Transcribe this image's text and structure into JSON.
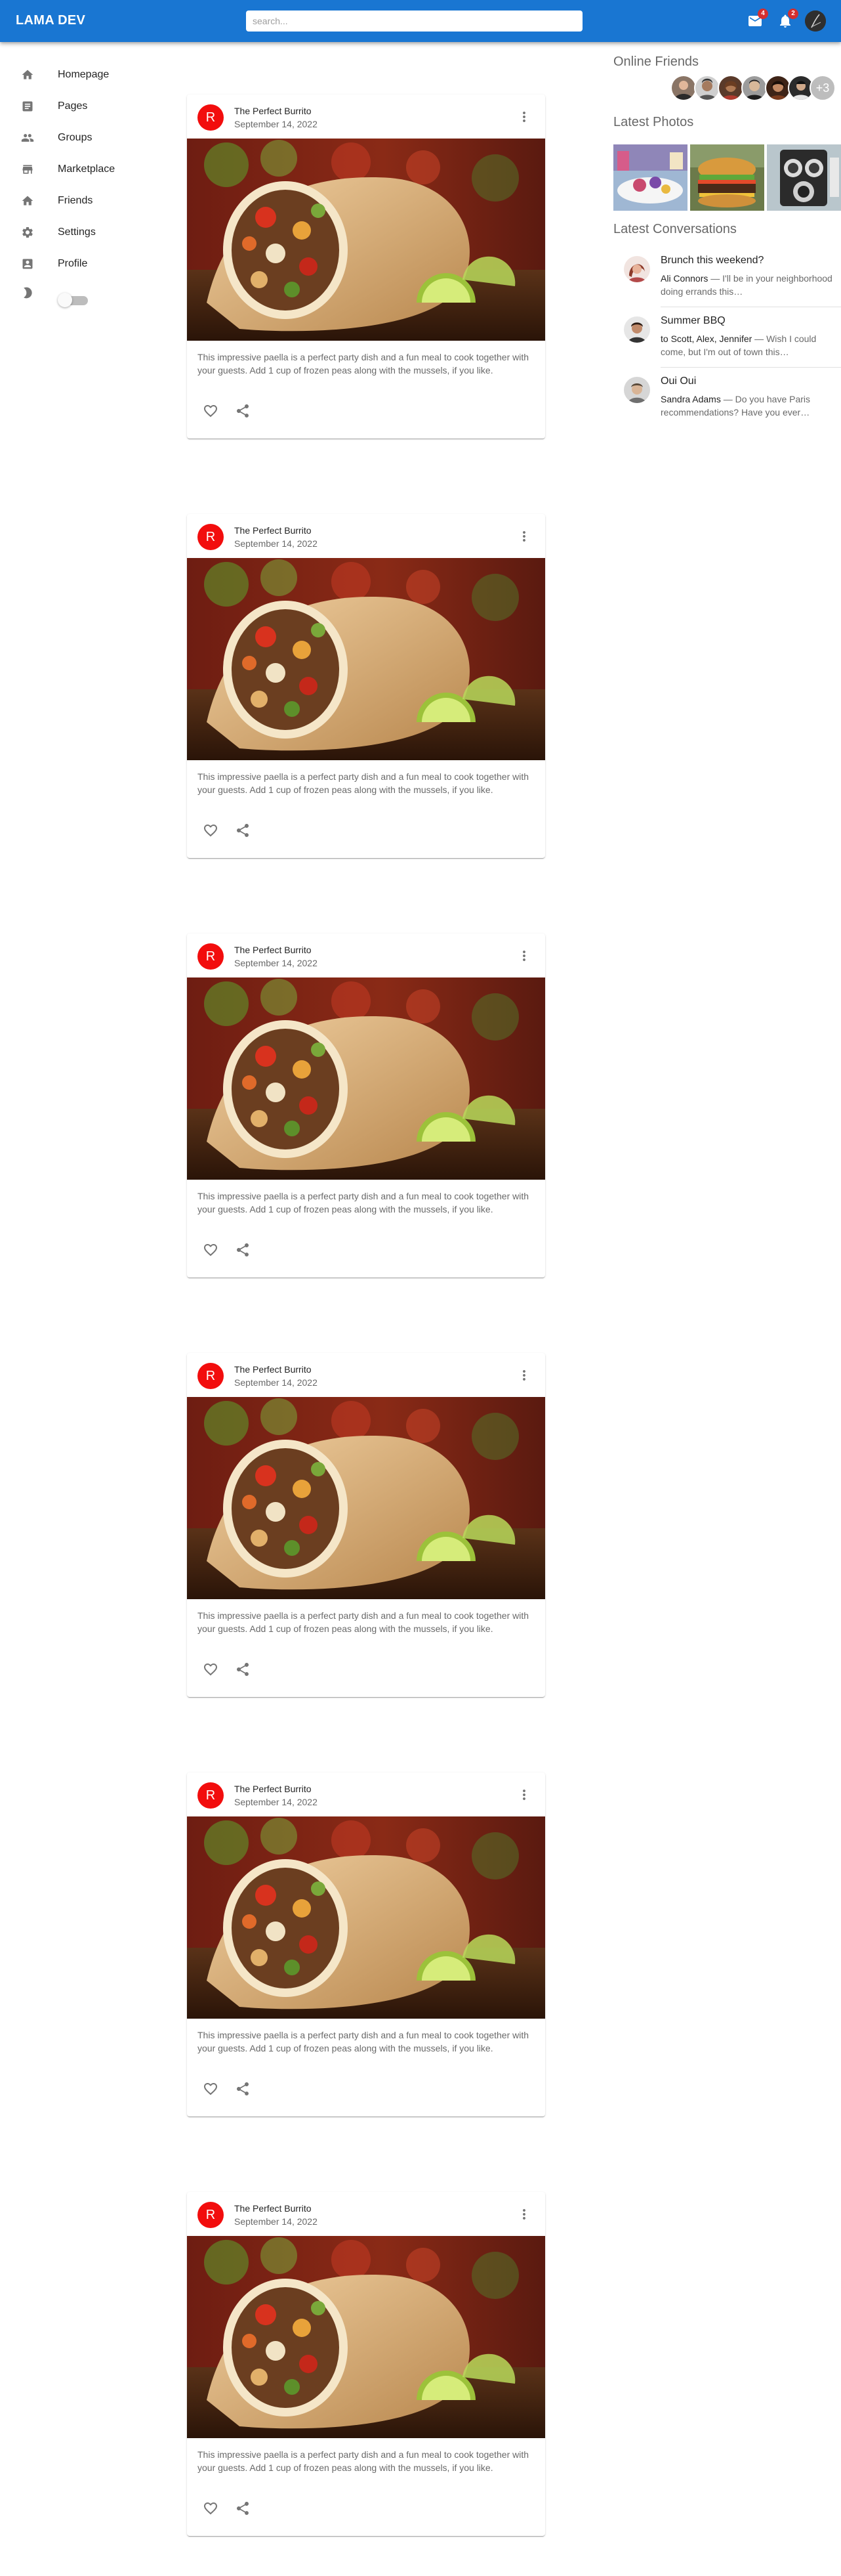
{
  "app": {
    "title": "LAMA DEV"
  },
  "search": {
    "placeholder": "search..."
  },
  "header": {
    "mail_badge": "4",
    "notifications_badge": "2"
  },
  "sidebar": {
    "items": [
      {
        "label": "Homepage",
        "icon": "home-icon"
      },
      {
        "label": "Pages",
        "icon": "article-icon"
      },
      {
        "label": "Groups",
        "icon": "group-icon"
      },
      {
        "label": "Marketplace",
        "icon": "storefront-icon"
      },
      {
        "label": "Friends",
        "icon": "home-icon"
      },
      {
        "label": "Settings",
        "icon": "settings-icon"
      },
      {
        "label": "Profile",
        "icon": "account-box-icon"
      }
    ],
    "dark_mode_enabled": false
  },
  "feed": {
    "posts": [
      {
        "avatar_letter": "R",
        "title": "The Perfect Burrito",
        "date": "September 14, 2022",
        "text": "This impressive paella is a perfect party dish and a fun meal to cook together with your guests. Add 1 cup of frozen peas along with the mussels, if you like."
      },
      {
        "avatar_letter": "R",
        "title": "The Perfect Burrito",
        "date": "September 14, 2022",
        "text": "This impressive paella is a perfect party dish and a fun meal to cook together with your guests. Add 1 cup of frozen peas along with the mussels, if you like."
      },
      {
        "avatar_letter": "R",
        "title": "The Perfect Burrito",
        "date": "September 14, 2022",
        "text": "This impressive paella is a perfect party dish and a fun meal to cook together with your guests. Add 1 cup of frozen peas along with the mussels, if you like."
      },
      {
        "avatar_letter": "R",
        "title": "The Perfect Burrito",
        "date": "September 14, 2022",
        "text": "This impressive paella is a perfect party dish and a fun meal to cook together with your guests. Add 1 cup of frozen peas along with the mussels, if you like."
      },
      {
        "avatar_letter": "R",
        "title": "The Perfect Burrito",
        "date": "September 14, 2022",
        "text": "This impressive paella is a perfect party dish and a fun meal to cook together with your guests. Add 1 cup of frozen peas along with the mussels, if you like."
      },
      {
        "avatar_letter": "R",
        "title": "The Perfect Burrito",
        "date": "September 14, 2022",
        "text": "This impressive paella is a perfect party dish and a fun meal to cook together with your guests. Add 1 cup of frozen peas along with the mussels, if you like."
      }
    ]
  },
  "rightbar": {
    "online_friends_title": "Online Friends",
    "online_friends_more": "+3",
    "latest_photos_title": "Latest Photos",
    "latest_conversations_title": "Latest Conversations",
    "conversations": [
      {
        "title": "Brunch this weekend?",
        "who": "Ali Connors",
        "message": " — I'll be in your neighborhood doing errands this…"
      },
      {
        "title": "Summer BBQ",
        "who": "to Scott, Alex, Jennifer",
        "message": " — Wish I could come, but I'm out of town this…"
      },
      {
        "title": "Oui Oui",
        "who": "Sandra Adams",
        "message": " — Do you have Paris recommendations? Have you ever…"
      }
    ]
  },
  "colors": {
    "appbar": "#1976d2",
    "post_avatar": "#f20d0d",
    "badge": "#d32f2f"
  }
}
